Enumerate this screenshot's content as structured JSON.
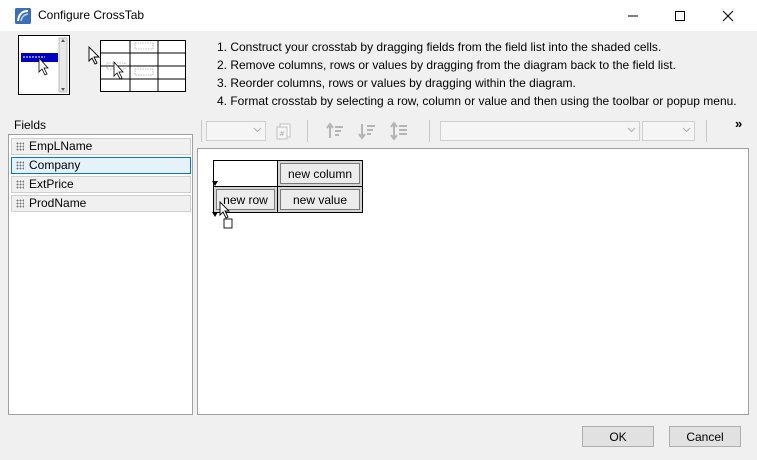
{
  "window": {
    "title": "Configure CrossTab"
  },
  "instructions": [
    "1. Construct your crosstab by dragging fields from the field list into the shaded cells.",
    "2. Remove columns, rows or values by dragging from the diagram back to the field list.",
    "3. Reorder columns, rows or values by dragging within the diagram.",
    "4. Format crosstab by selecting a row, column or value and then using the toolbar or popup menu."
  ],
  "fields": {
    "label": "Fields",
    "items": [
      "EmpLName",
      "Company",
      "ExtPrice",
      "ProdName"
    ],
    "selected": "Company"
  },
  "toolbar": {
    "overflow": "»"
  },
  "diagram": {
    "column_cell": "new column",
    "row_cell": "new row",
    "value_cell": "new value"
  },
  "buttons": {
    "ok": "OK",
    "cancel": "Cancel"
  },
  "colors": {
    "selection_border": "#0078d7",
    "cell_fill": "#d4d4d4",
    "illustration_highlight": "#0000c0"
  },
  "icons": [
    "app-icon",
    "minimize-icon",
    "maximize-icon",
    "close-icon",
    "grip-icon",
    "move-cursor-icon",
    "sort-icon",
    "sort-descending-icon",
    "sort-ascending-icon",
    "chevron-down-icon"
  ]
}
